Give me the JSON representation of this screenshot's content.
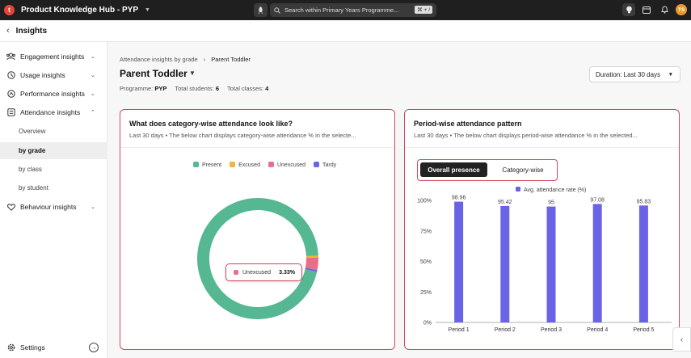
{
  "app": {
    "title": "Product Knowledge Hub - PYP",
    "logo_letter": "t",
    "search_placeholder": "Search within Primary Years Programme...",
    "search_shortcut": "⌘ + /",
    "avatar_initials": "TS"
  },
  "header": {
    "title": "Insights"
  },
  "sidebar": {
    "items": [
      {
        "label": "Engagement insights",
        "icon": "engagement-icon"
      },
      {
        "label": "Usage insights",
        "icon": "usage-icon"
      },
      {
        "label": "Performance insights",
        "icon": "performance-icon"
      },
      {
        "label": "Attendance insights",
        "icon": "attendance-icon"
      },
      {
        "label": "Behaviour insights",
        "icon": "heart-icon"
      }
    ],
    "sub_items": [
      {
        "label": "Overview"
      },
      {
        "label": "by grade"
      },
      {
        "label": "by class"
      },
      {
        "label": "by student"
      }
    ],
    "settings_label": "Settings"
  },
  "main": {
    "breadcrumb_parent": "Attendance insights by grade",
    "breadcrumb_current": "Parent Toddler",
    "title": "Parent Toddler",
    "programme_label": "Programme:",
    "programme_value": "PYP",
    "students_label": "Total students:",
    "students_value": "6",
    "classes_label": "Total classes:",
    "classes_value": "4",
    "duration": "Duration: Last 30 days"
  },
  "card_left": {
    "title": "What does category-wise attendance look like?",
    "subtitle": "Last 30 days  •  The below chart displays category-wise attendance % in the selecte...",
    "tooltip_label": "Unexcused",
    "tooltip_value": "3.33%"
  },
  "card_right": {
    "title": "Period-wise attendance pattern",
    "subtitle": "Last 30 days  •  The below chart displays period-wise attendance % in the selected...",
    "toggle_active": "Overall presence",
    "toggle_inactive": "Category-wise"
  },
  "colors": {
    "present": "#55b892",
    "excused": "#f2b43a",
    "unexcused": "#e86f8a",
    "tardy": "#6b63e6",
    "bar": "#6b63e6",
    "highlight": "#d2475f"
  },
  "chart_data": [
    {
      "type": "pie",
      "style": "donut",
      "labels": [
        "Present",
        "Excused",
        "Unexcused",
        "Tardy"
      ],
      "values": [
        95.67,
        0.5,
        3.33,
        0.5
      ],
      "legend": "top"
    },
    {
      "type": "bar",
      "categories": [
        "Period 1",
        "Period 2",
        "Period 3",
        "Period 4",
        "Period 5"
      ],
      "series": [
        {
          "name": "Avg. attendance rate (%)",
          "values": [
            98.96,
            95.42,
            95,
            97.08,
            95.83
          ]
        }
      ],
      "data_labels": [
        "98.96",
        "95.42",
        "95",
        "97.08",
        "95.83"
      ],
      "ylim": [
        0,
        100
      ],
      "yticks": [
        "0%",
        "25%",
        "50%",
        "75%",
        "100%"
      ],
      "legend": "top",
      "grid": false
    }
  ]
}
